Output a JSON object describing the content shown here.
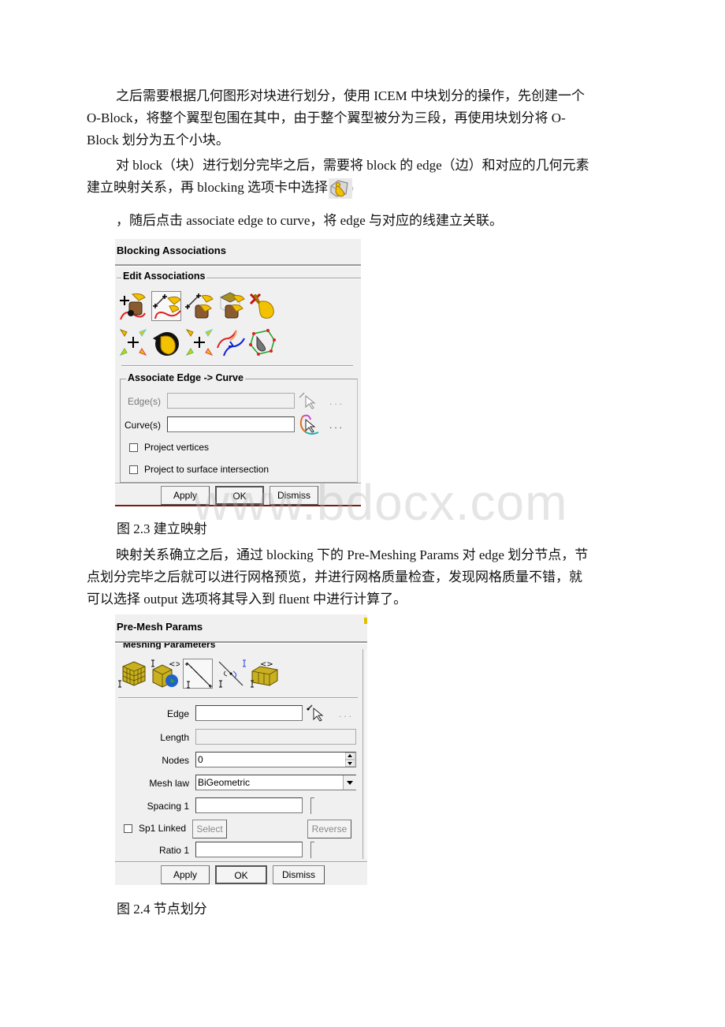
{
  "paragraphs": {
    "p1": [
      "之后需要根据几何图形对块进行划分，使用 ICEM 中块划分的操作，先创建一个",
      "O-Block，将整个翼型包围在其中，由于整个翼型被分为三段，再使用块划分将 O-",
      "Block 划分为五个小块。"
    ],
    "p2": [
      "对 block（块）进行划分完毕之后，需要将 block 的 edge（边）和对应的几何元素",
      "建立映射关系，再 blocking 选项卡中选择"
    ],
    "p2_icon": "associate-hand-icon",
    "p3": "，随后点击 associate edge to curve，将 edge 与对应的线建立关联。",
    "p4": [
      "映射关系确立之后，通过 blocking 下的 Pre-Meshing Params 对 edge 划分节点，节",
      "点划分完毕之后就可以进行网格预览，并进行网格质量检查，发现网格质量不错，就",
      "可以选择 output 选项将其导入到 fluent 中进行计算了。"
    ]
  },
  "figure1": {
    "caption": "图 2.3 建立映射",
    "dialog": {
      "title": "Blocking Associations",
      "group_edit": "Edit Associations",
      "toolbar_row1": [
        "associate-vertex-icon",
        "associate-edge-to-curve-icon",
        "associate-edge-to-surface-icon",
        "associate-face-to-surface-icon",
        "disassociate-icon"
      ],
      "toolbar_row2": [
        "reset-associations-icon",
        "update-associations-icon",
        "snap-vertices-icon",
        "group-curves-icon",
        "auto-associate-icon"
      ],
      "selected_tool_index": 1,
      "group_assoc": "Associate Edge -> Curve",
      "edges_label": "Edge(s)",
      "edges_value": "",
      "curves_label": "Curve(s)",
      "curves_value": "",
      "dots": "...",
      "project_vertices": {
        "label": "Project vertices",
        "checked": false
      },
      "project_surface": {
        "label": "Project to surface intersection",
        "checked": false
      },
      "buttons": {
        "apply": "Apply",
        "ok": "OK",
        "dismiss": "Dismiss"
      }
    }
  },
  "figure2": {
    "caption": "图 2.4 节点划分",
    "dialog": {
      "title": "Pre-Mesh Params",
      "group": "Meshing Parameters",
      "toolbar": [
        "update-all-icon",
        "scale-sizes-icon",
        "edge-params-icon",
        "match-edges-icon",
        "refinement-icon"
      ],
      "selected_tool_index": 2,
      "edge_label": "Edge",
      "edge_value": "",
      "length_label": "Length",
      "length_value": "",
      "nodes_label": "Nodes",
      "nodes_value": "0",
      "meshlaw_label": "Mesh law",
      "meshlaw_value": "BiGeometric",
      "spacing1_label": "Spacing 1",
      "spacing1_value": "",
      "sp1_linked": {
        "label": "Sp1 Linked",
        "checked": false
      },
      "select_label": "Select",
      "reverse_label": "Reverse",
      "ratio1_label": "Ratio 1",
      "ratio1_value": "",
      "dots": "...",
      "buttons": {
        "apply": "Apply",
        "ok": "OK",
        "dismiss": "Dismiss"
      }
    }
  },
  "watermark": "www.bdocx.com"
}
